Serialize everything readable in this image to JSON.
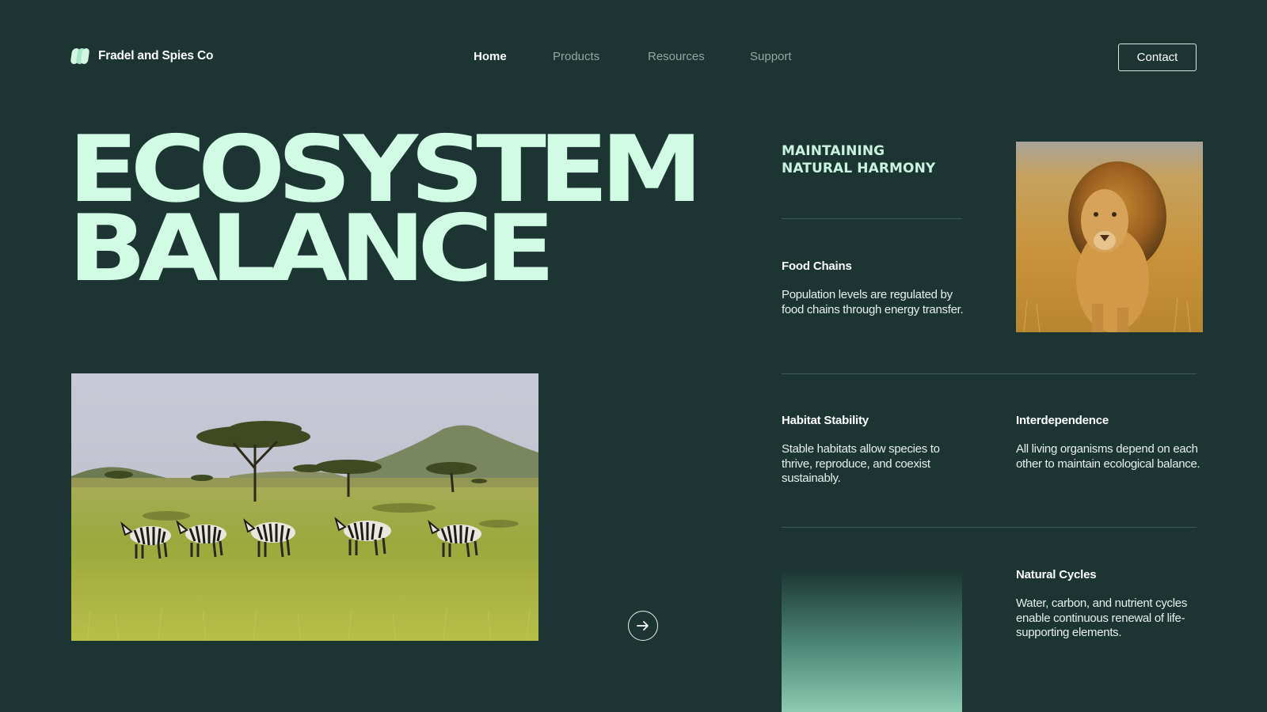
{
  "header": {
    "brand": "Fradel and Spies Co",
    "nav": [
      {
        "label": "Home",
        "active": true
      },
      {
        "label": "Products",
        "active": false
      },
      {
        "label": "Resources",
        "active": false
      },
      {
        "label": "Support",
        "active": false
      }
    ],
    "contact_label": "Contact"
  },
  "hero": {
    "title_line1": "ECOSYSTEM",
    "title_line2": "BALANCE"
  },
  "side": {
    "heading_line1": "MAINTAINING",
    "heading_line2": "NATURAL HARMONY"
  },
  "features": [
    {
      "title": "Food Chains",
      "description": "Population levels are regulated by food chains through energy transfer."
    },
    {
      "title": "Habitat Stability",
      "description": "Stable habitats allow species to thrive, reproduce, and coexist sustainably."
    },
    {
      "title": "Interdependence",
      "description": "All living organisms depend on each other to maintain ecological balance."
    },
    {
      "title": "Natural Cycles",
      "description": "Water, carbon, and nutrient cycles enable continuous renewal of life-supporting elements."
    }
  ],
  "colors": {
    "background": "#1c3532",
    "accent": "#d2fbe6",
    "nav_inactive": "#8fa8a3",
    "divider": "#3d5a55"
  },
  "icons": {
    "brand": "logo-icon",
    "next": "arrow-right-circle-icon"
  }
}
